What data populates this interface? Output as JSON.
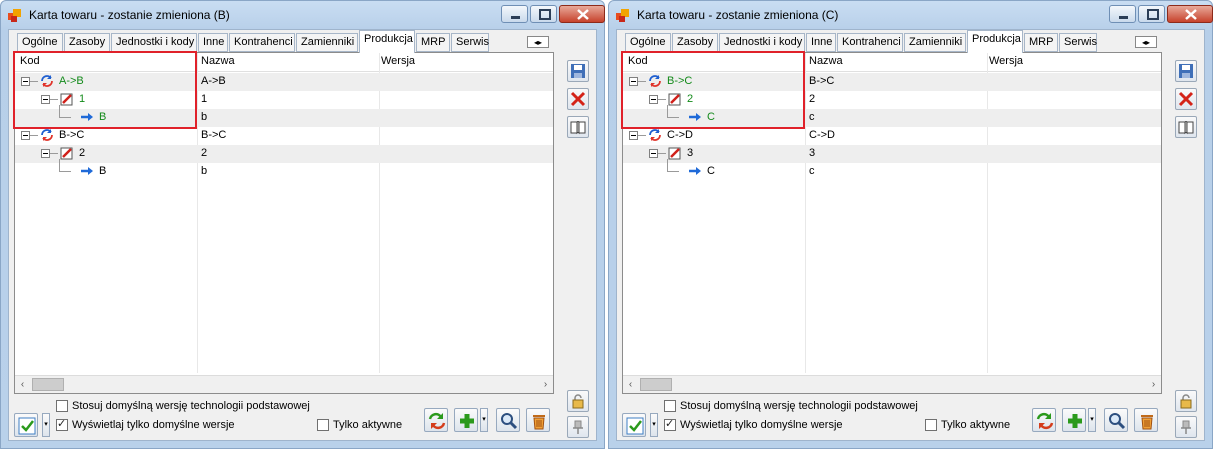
{
  "windows": [
    {
      "title": "Karta towaru - zostanie zmieniona (B)",
      "tabs": [
        "Ogólne",
        "Zasoby",
        "Jednostki i kody",
        "Inne",
        "Kontrahenci",
        "Zamienniki",
        "Produkcja",
        "MRP",
        "Serwis"
      ],
      "active_tab": "Produkcja",
      "columns": [
        "Kod",
        "Nazwa",
        "Wersja"
      ],
      "rows": [
        {
          "kod": "A->B",
          "nazwa": "A->B",
          "wersja": "",
          "level": 0,
          "icon": "refresh-icon",
          "green": true
        },
        {
          "kod": "1",
          "nazwa": "1",
          "wersja": "",
          "level": 1,
          "icon": "checkbox-red-icon",
          "green": true
        },
        {
          "kod": "B",
          "nazwa": "b",
          "wersja": "",
          "level": 2,
          "icon": "arrow-right-icon",
          "green": true
        },
        {
          "kod": "B->C",
          "nazwa": "B->C",
          "wersja": "",
          "level": 0,
          "icon": "refresh-icon",
          "green": false
        },
        {
          "kod": "2",
          "nazwa": "2",
          "wersja": "",
          "level": 1,
          "icon": "checkbox-red-icon",
          "green": false
        },
        {
          "kod": "B",
          "nazwa": "b",
          "wersja": "",
          "level": 2,
          "icon": "arrow-right-icon",
          "green": false
        }
      ],
      "options": {
        "default_version": "Stosuj domyślną wersję technologii podstawowej",
        "default_only": "Wyświetlaj tylko domyślne wersje",
        "active_only": "Tylko aktywne"
      }
    },
    {
      "title": "Karta towaru - zostanie zmieniona (C)",
      "tabs": [
        "Ogólne",
        "Zasoby",
        "Jednostki i kody",
        "Inne",
        "Kontrahenci",
        "Zamienniki",
        "Produkcja",
        "MRP",
        "Serwis"
      ],
      "active_tab": "Produkcja",
      "columns": [
        "Kod",
        "Nazwa",
        "Wersja"
      ],
      "rows": [
        {
          "kod": "B->C",
          "nazwa": "B->C",
          "wersja": "",
          "level": 0,
          "icon": "refresh-icon",
          "green": true
        },
        {
          "kod": "2",
          "nazwa": "2",
          "wersja": "",
          "level": 1,
          "icon": "checkbox-red-icon",
          "green": true
        },
        {
          "kod": "C",
          "nazwa": "c",
          "wersja": "",
          "level": 2,
          "icon": "arrow-right-icon",
          "green": true
        },
        {
          "kod": "C->D",
          "nazwa": "C->D",
          "wersja": "",
          "level": 0,
          "icon": "refresh-icon",
          "green": false
        },
        {
          "kod": "3",
          "nazwa": "3",
          "wersja": "",
          "level": 1,
          "icon": "checkbox-red-icon",
          "green": false
        },
        {
          "kod": "C",
          "nazwa": "c",
          "wersja": "",
          "level": 2,
          "icon": "arrow-right-icon",
          "green": false
        }
      ],
      "options": {
        "default_version": "Stosuj domyślną wersję technologii podstawowej",
        "default_only": "Wyświetlaj tylko domyślne wersje",
        "active_only": "Tylko aktywne"
      }
    }
  ],
  "checkbox_states": {
    "default_version": false,
    "default_only": true,
    "active_only": false
  },
  "colors": {
    "highlight_box": "#e0212a",
    "green_text": "#138a1a",
    "alt_row": "#eeeeee"
  }
}
